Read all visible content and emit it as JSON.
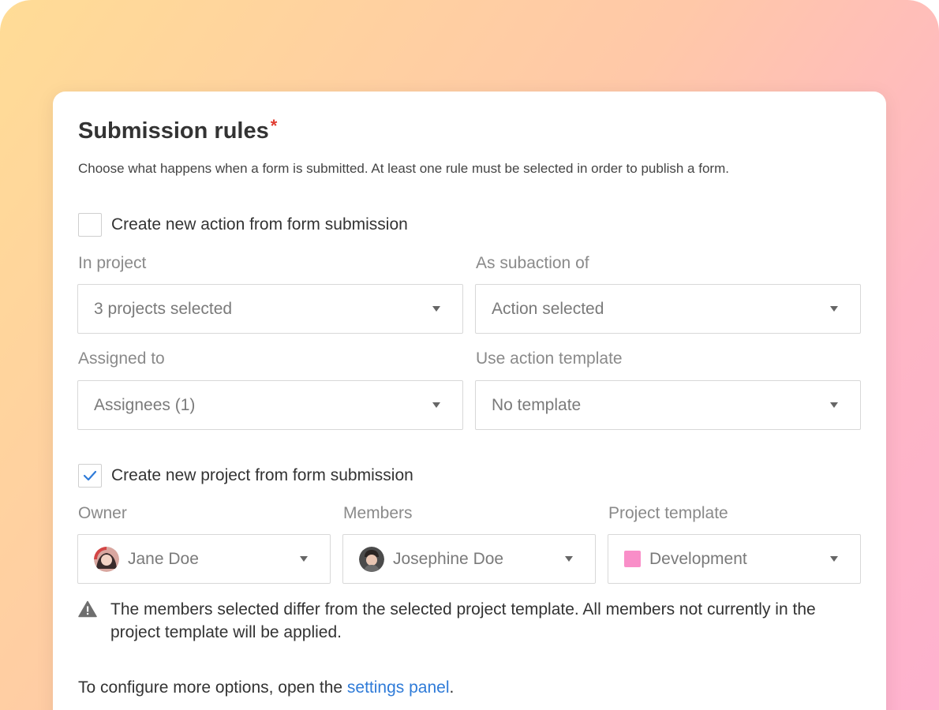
{
  "section": {
    "title": "Submission rules",
    "required_mark": "*",
    "description": "Choose what happens when a form is submitted. At least one rule must be selected in order to publish a form."
  },
  "action_rule": {
    "checked": false,
    "label": "Create new action from form submission",
    "fields": {
      "in_project": {
        "label": "In project",
        "value": "3 projects selected"
      },
      "as_subaction_of": {
        "label": "As subaction of",
        "value": "Action selected"
      },
      "assigned_to": {
        "label": "Assigned to",
        "value": "Assignees (1)"
      },
      "use_action_template": {
        "label": "Use action template",
        "value": "No template"
      }
    }
  },
  "project_rule": {
    "checked": true,
    "label": "Create new project from form submission",
    "fields": {
      "owner": {
        "label": "Owner",
        "value": "Jane Doe"
      },
      "members": {
        "label": "Members",
        "value": "Josephine Doe"
      },
      "project_template": {
        "label": "Project template",
        "value": "Development",
        "color": "#f98ec8"
      }
    }
  },
  "warning": {
    "icon": "warning-triangle-icon",
    "text": "The members selected differ from the selected project template. All members not currently in the project template will be applied."
  },
  "footer": {
    "prefix": "To configure more options, open the ",
    "link_text": "settings panel",
    "suffix": "."
  },
  "colors": {
    "accent": "#2f7bd8",
    "required": "#e03c31",
    "checkmark": "#2f7bd8"
  }
}
